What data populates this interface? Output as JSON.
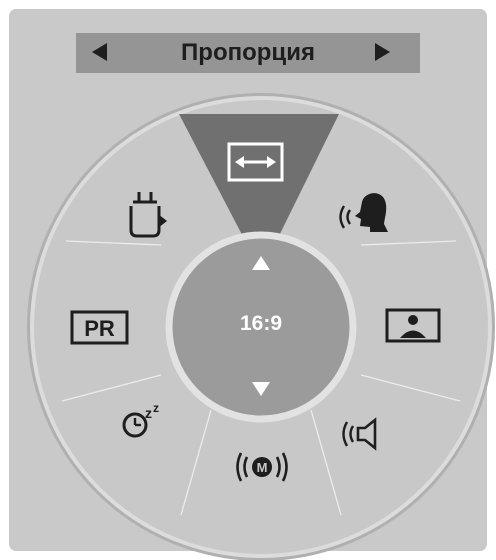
{
  "header": {
    "title": "Пропорция",
    "prev_icon": "triangle-left-icon",
    "next_icon": "triangle-right-icon"
  },
  "wheel": {
    "center_value": "16:9",
    "up_icon": "triangle-up-icon",
    "down_icon": "triangle-down-icon",
    "selected_item": "aspect-ratio",
    "items": [
      {
        "id": "aspect-ratio",
        "icon": "arrows-left-right-icon",
        "selected": true
      },
      {
        "id": "clear-voice",
        "icon": "speaking-head-icon"
      },
      {
        "id": "picture-mode",
        "icon": "picture-person-icon"
      },
      {
        "id": "sound-mode",
        "icon": "speaker-waves-icon"
      },
      {
        "id": "audio-mono",
        "icon": "m-waves-icon"
      },
      {
        "id": "sleep-timer",
        "icon": "clock-zzz-icon"
      },
      {
        "id": "program-list",
        "icon": "pr-icon",
        "label": "PR"
      },
      {
        "id": "input",
        "icon": "input-plug-icon"
      }
    ]
  },
  "colors": {
    "panel": "#c9c9c9",
    "header_bar": "#959595",
    "wheel_face": "#c8c8c8",
    "wheel_ring": "#a8a8a8",
    "selected_sector": "#707070",
    "hub": "#9b9b9b",
    "hub_ring": "#e2e2e2",
    "icon": "#1e1e1e"
  }
}
